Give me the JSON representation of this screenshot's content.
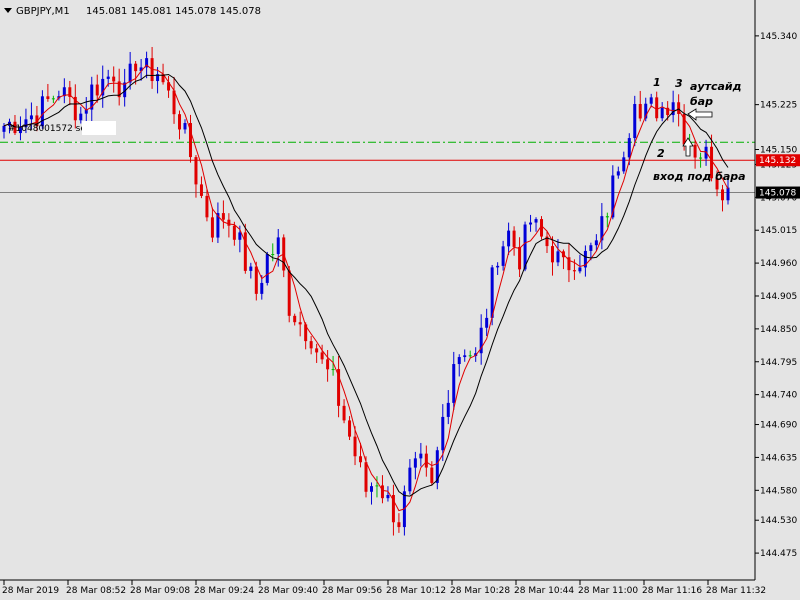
{
  "header": {
    "symbol": "GBPJPY,M1",
    "ohlc": "145.081 145.081 145.078 145.078"
  },
  "order_label": "#1048001572 sel",
  "colors": {
    "background": "#e4e4e4",
    "bull_candle": "#0000d8",
    "bear_candle": "#e00000",
    "doji_candle": "#00b400",
    "ma_fast": "#e00000",
    "ma_slow": "#000000",
    "level_line": "#e00000",
    "bid_line": "#808080",
    "tp_line": "#00b000"
  },
  "annotations": {
    "n1": "1",
    "n2": "2",
    "n3": "3",
    "outside_bar_line1": "аутсайд",
    "outside_bar_line2": "бар",
    "entry_text": "вход под бара"
  },
  "chart_data": {
    "type": "candlestick",
    "title": "GBPJPY,M1",
    "ylim": [
      144.43,
      145.4
    ],
    "y_ticks": [
      "145.340",
      "145.225",
      "145.150",
      "145.125",
      "145.070",
      "145.015",
      "144.960",
      "144.905",
      "144.850",
      "144.795",
      "144.740",
      "144.690",
      "144.635",
      "144.580",
      "144.530",
      "144.475"
    ],
    "x_ticks": [
      "28 Mar 2019",
      "28 Mar 08:52",
      "28 Mar 09:08",
      "28 Mar 09:24",
      "28 Mar 09:40",
      "28 Mar 09:56",
      "28 Mar 10:12",
      "28 Mar 10:28",
      "28 Mar 10:44",
      "28 Mar 11:00",
      "28 Mar 11:16",
      "28 Mar 11:32"
    ],
    "levels": {
      "order_level": {
        "value": 145.132,
        "label": "145.132"
      },
      "bid": {
        "value": 145.078,
        "label": "145.078"
      },
      "take_profit": {
        "value": 145.162
      }
    },
    "path": [
      [
        0,
        145.19
      ],
      [
        6,
        145.21
      ],
      [
        10,
        145.25
      ],
      [
        14,
        145.21
      ],
      [
        16,
        145.25
      ],
      [
        20,
        145.28
      ],
      [
        22,
        145.24
      ],
      [
        24,
        145.3
      ],
      [
        26,
        145.28
      ],
      [
        28,
        145.28
      ],
      [
        30,
        145.24
      ],
      [
        32,
        145.2
      ],
      [
        34,
        145.14
      ],
      [
        36,
        145.07
      ],
      [
        38,
        145.02
      ],
      [
        40,
        145.04
      ],
      [
        42,
        145.02
      ],
      [
        44,
        144.96
      ],
      [
        46,
        144.91
      ],
      [
        48,
        144.97
      ],
      [
        50,
        144.99
      ],
      [
        52,
        144.89
      ],
      [
        54,
        144.86
      ],
      [
        56,
        144.84
      ],
      [
        58,
        144.79
      ],
      [
        60,
        144.76
      ],
      [
        62,
        144.7
      ],
      [
        64,
        144.64
      ],
      [
        66,
        144.58
      ],
      [
        68,
        144.6
      ],
      [
        70,
        144.56
      ],
      [
        72,
        144.53
      ],
      [
        74,
        144.6
      ],
      [
        76,
        144.62
      ],
      [
        78,
        144.58
      ],
      [
        80,
        144.7
      ],
      [
        82,
        144.8
      ],
      [
        84,
        144.82
      ],
      [
        86,
        144.8
      ],
      [
        88,
        144.88
      ],
      [
        90,
        144.98
      ],
      [
        92,
        145.01
      ],
      [
        94,
        144.97
      ],
      [
        96,
        145.03
      ],
      [
        98,
        145.0
      ],
      [
        100,
        144.98
      ],
      [
        102,
        144.95
      ],
      [
        104,
        144.97
      ],
      [
        106,
        144.97
      ],
      [
        108,
        144.99
      ],
      [
        110,
        145.05
      ],
      [
        112,
        145.13
      ],
      [
        114,
        145.19
      ],
      [
        115,
        145.25
      ],
      [
        116,
        145.2
      ],
      [
        118,
        145.22
      ],
      [
        120,
        145.22
      ],
      [
        122,
        145.24
      ],
      [
        124,
        145.18
      ],
      [
        126,
        145.15
      ],
      [
        128,
        145.14
      ],
      [
        130,
        145.1
      ],
      [
        132,
        145.08
      ]
    ]
  }
}
